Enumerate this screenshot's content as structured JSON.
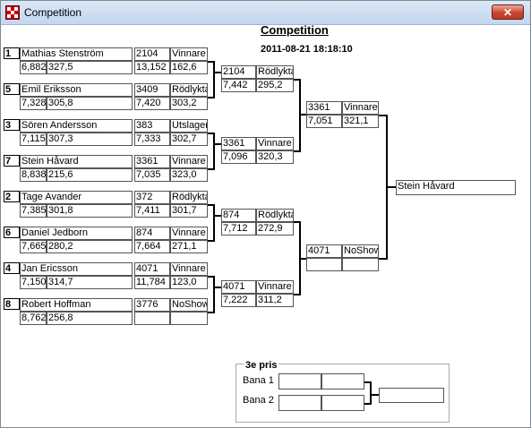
{
  "window": {
    "title": "Competition"
  },
  "page": {
    "title": "Competition",
    "datetime": "2011-08-21  18:18:10"
  },
  "round1": [
    {
      "seed": "1",
      "name": "Mathias Stenström",
      "r1": "6,882",
      "r2": "327,5",
      "num": "2104",
      "status": "Vinnare",
      "t1": "13,152",
      "t2": "162,6"
    },
    {
      "seed": "5",
      "name": "Emil Eriksson",
      "r1": "7,328",
      "r2": "305,8",
      "num": "3409",
      "status": "Rödlykta",
      "t1": "7,420",
      "t2": "303,2"
    },
    {
      "seed": "3",
      "name": "Sören Andersson",
      "r1": "7,115",
      "r2": "307,3",
      "num": "383",
      "status": "Utslagen",
      "t1": "7,333",
      "t2": "302,7"
    },
    {
      "seed": "7",
      "name": "Stein Håvard",
      "r1": "8,838",
      "r2": "215,6",
      "num": "3361",
      "status": "Vinnare",
      "t1": "7,035",
      "t2": "323,0"
    },
    {
      "seed": "2",
      "name": "Tage Avander",
      "r1": "7,385",
      "r2": "301,8",
      "num": "372",
      "status": "Rödlykta",
      "t1": "7,411",
      "t2": "301,7"
    },
    {
      "seed": "6",
      "name": "Daniel Jedborn",
      "r1": "7,665",
      "r2": "280,2",
      "num": "874",
      "status": "Vinnare",
      "t1": "7,664",
      "t2": "271,1"
    },
    {
      "seed": "4",
      "name": "Jan Ericsson",
      "r1": "7,150",
      "r2": "314,7",
      "num": "4071",
      "status": "Vinnare",
      "t1": "11,784",
      "t2": "123,0"
    },
    {
      "seed": "8",
      "name": "Robert Hoffman",
      "r1": "8,762",
      "r2": "256,8",
      "num": "3776",
      "status": "NoShow",
      "t1": "",
      "t2": ""
    }
  ],
  "round2": [
    {
      "num": "2104",
      "status": "Rödlykta",
      "t1": "7,442",
      "t2": "295,2"
    },
    {
      "num": "3361",
      "status": "Vinnare",
      "t1": "7,096",
      "t2": "320,3"
    },
    {
      "num": "874",
      "status": "Rödlykta",
      "t1": "7,712",
      "t2": "272,9"
    },
    {
      "num": "4071",
      "status": "Vinnare",
      "t1": "7,222",
      "t2": "311,2"
    }
  ],
  "semis": [
    {
      "num": "3361",
      "status": "Vinnare",
      "t1": "7,051",
      "t2": "321,1"
    },
    {
      "num": "4071",
      "status": "NoShow",
      "t1": "",
      "t2": ""
    }
  ],
  "final": {
    "winner": "Stein Håvard"
  },
  "third_place": {
    "title": "3e pris",
    "lane1": "Bana 1",
    "lane2": "Bana 2"
  }
}
